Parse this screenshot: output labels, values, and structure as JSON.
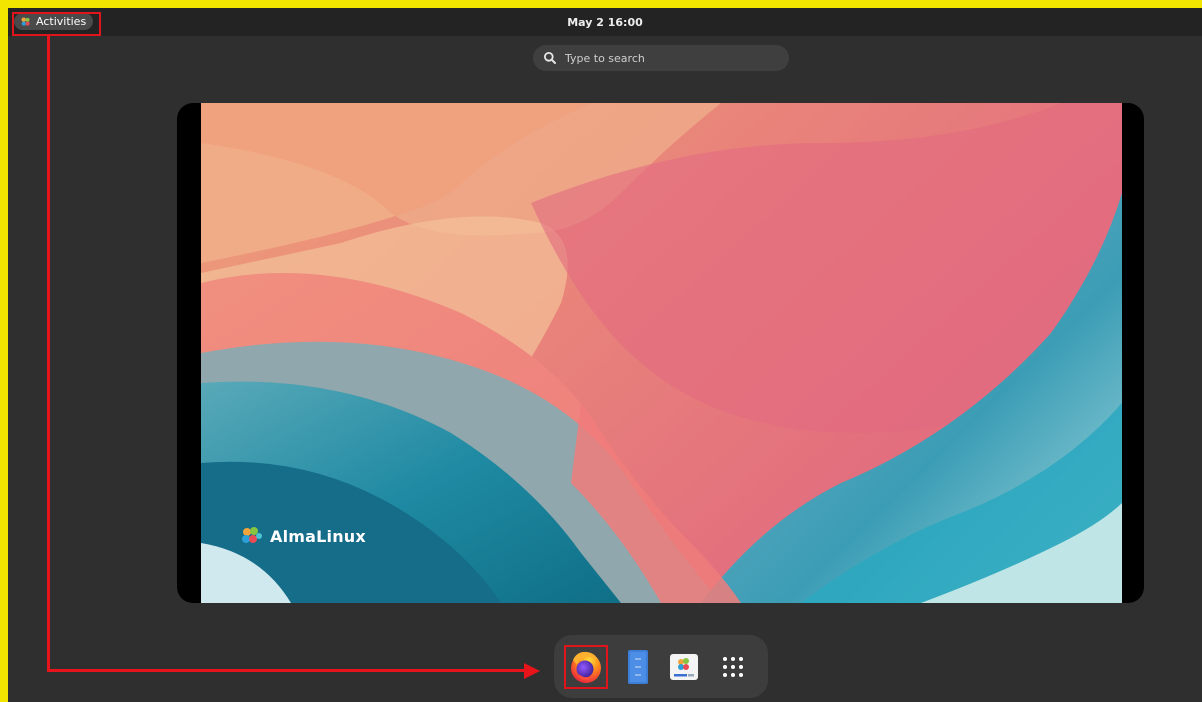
{
  "topbar": {
    "activities_label": "Activities",
    "clock": "May 2  16:00"
  },
  "search": {
    "placeholder": "Type to search"
  },
  "workspace": {
    "brand_text": "AlmaLinux"
  },
  "dock": {
    "items": [
      {
        "name": "firefox",
        "icon": "firefox-icon",
        "highlighted": true
      },
      {
        "name": "files",
        "icon": "files-icon"
      },
      {
        "name": "software",
        "icon": "software-center-icon"
      },
      {
        "name": "show-apps",
        "icon": "app-grid-icon"
      }
    ]
  },
  "annotation": {
    "color": "#e8141b",
    "border_color": "#f2e600"
  }
}
